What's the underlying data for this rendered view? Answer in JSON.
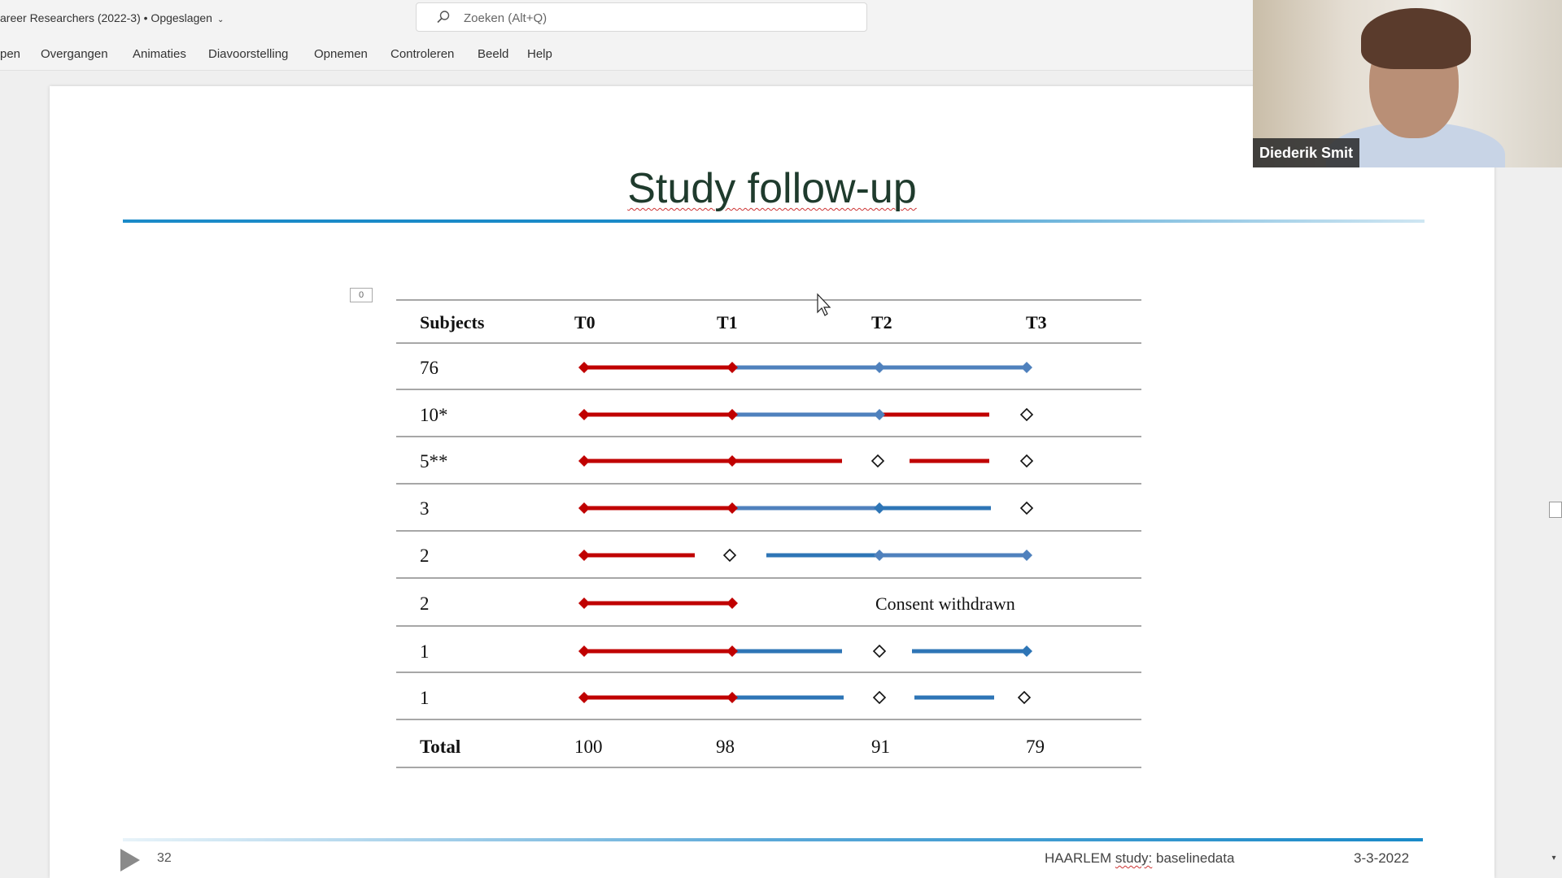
{
  "titlebar": {
    "document_title": "areer Researchers (2022-3) • Opgeslagen",
    "caret": "⌄"
  },
  "search": {
    "placeholder": "Zoeken (Alt+Q)"
  },
  "ribbon": {
    "tabs": [
      "pen",
      "Overgangen",
      "Animaties",
      "Diavoorstelling",
      "Opnemen",
      "Controleren",
      "Beeld",
      "Help"
    ]
  },
  "slide": {
    "title": "Study follow-up",
    "placeholder_label": "0",
    "number": "32",
    "footer_title_word": "HAARLEM",
    "footer_title_rest": " study: baselinedata",
    "footer_title_sq": "study:",
    "footer_date": "3-3-2022"
  },
  "table": {
    "headers": [
      "Subjects",
      "T0",
      "T1",
      "T2",
      "T3"
    ],
    "rows": [
      {
        "label": "76"
      },
      {
        "label": "10*"
      },
      {
        "label": "5**"
      },
      {
        "label": "3"
      },
      {
        "label": "2"
      },
      {
        "label": "2",
        "note": "Consent withdrawn"
      },
      {
        "label": "1"
      },
      {
        "label": "1"
      }
    ],
    "total": {
      "label": "Total",
      "values": [
        "100",
        "98",
        "91",
        "79"
      ]
    }
  },
  "colors": {
    "red": "#c00000",
    "blue": "#2e75b6",
    "light_blue": "#4f81bd"
  },
  "video": {
    "participant_name": "Diederik Smit"
  }
}
